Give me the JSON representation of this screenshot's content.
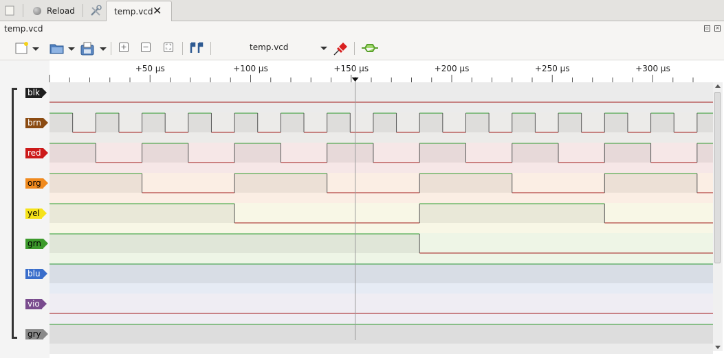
{
  "tabs": {
    "reload_label": "Reload",
    "file_tab_label": "temp.vcd",
    "close_glyph": "✕"
  },
  "panel": {
    "title": "temp.vcd"
  },
  "toolbar": {
    "file_selector": "temp.vcd",
    "icons": [
      "new-file-icon",
      "open-folder-icon",
      "save-icon",
      "zoom-in-icon",
      "zoom-out-icon",
      "zoom-fit-icon",
      "marker-icon",
      "pin-icon",
      "signal-select-icon"
    ]
  },
  "timeline": {
    "ticks": [
      "+50 µs",
      "+100 µs",
      "+150 µs",
      "+200 µs",
      "+250 µs",
      "+300 µs"
    ],
    "cursor_time_us": 152
  },
  "signals": [
    {
      "name": "blk",
      "color": "#1e1e1e",
      "text": "#ffffff",
      "bg": "#ebebeb",
      "period_us": 0,
      "high_start": false
    },
    {
      "name": "brn",
      "color": "#8b4b12",
      "text": "#ffffff",
      "bg": "#ecebe9",
      "period_us": 23,
      "high_start": true
    },
    {
      "name": "red",
      "color": "#cc1a1a",
      "text": "#ffffff",
      "bg": "#f6e7e7",
      "period_us": 46,
      "high_start": true
    },
    {
      "name": "org",
      "color": "#f08a1e",
      "text": "#000000",
      "bg": "#fbeee4",
      "period_us": 92,
      "high_start": true
    },
    {
      "name": "yel",
      "color": "#f5e21a",
      "text": "#000000",
      "bg": "#f8f7e6",
      "period_us": 184,
      "high_start": true
    },
    {
      "name": "grn",
      "color": "#3c9a2c",
      "text": "#000000",
      "bg": "#eef5e6",
      "period_us": 368,
      "high_start": true
    },
    {
      "name": "blu",
      "color": "#3a6ecb",
      "text": "#ffffff",
      "bg": "#e6ebf4",
      "period_us": 736,
      "high_start": true
    },
    {
      "name": "vio",
      "color": "#7a4c8e",
      "text": "#ffffff",
      "bg": "#efedf3",
      "period_us": 1472,
      "high_start": false
    },
    {
      "name": "gry",
      "color": "#8a8a8a",
      "text": "#000000",
      "bg": "#ebebeb",
      "period_us": 0,
      "high_start": true
    }
  ]
}
